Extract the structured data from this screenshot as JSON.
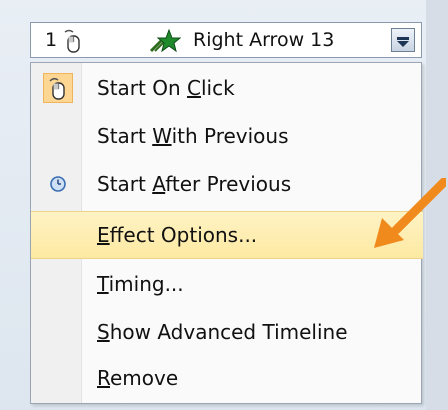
{
  "header": {
    "index": "1",
    "effect_name": "Right Arrow 13",
    "icons": {
      "trigger": "mouse-click-icon",
      "effect": "green-star-icon",
      "dropdown": "chevron-down-icon"
    }
  },
  "menu": {
    "items": [
      {
        "pre": "Start On ",
        "key": "C",
        "post": "lick",
        "icon": "mouse-click-icon",
        "selected": true
      },
      {
        "pre": "Start ",
        "key": "W",
        "post": "ith Previous",
        "icon": "",
        "selected": false
      },
      {
        "pre": "Start ",
        "key": "A",
        "post": "fter Previous",
        "icon": "clock-icon",
        "selected": false
      },
      {
        "pre": "",
        "key": "E",
        "post": "ffect Options...",
        "icon": "",
        "highlighted": true
      },
      {
        "pre": "",
        "key": "T",
        "post": "iming...",
        "icon": ""
      },
      {
        "pre": "",
        "key": "S",
        "post": "how Advanced Timeline",
        "icon": ""
      },
      {
        "pre": "",
        "key": "R",
        "post": "emove",
        "icon": ""
      }
    ]
  },
  "colors": {
    "highlight": "#fde9a2",
    "selected_icon_bg": "#fdd693",
    "annotation_arrow": "#f08a1c"
  }
}
